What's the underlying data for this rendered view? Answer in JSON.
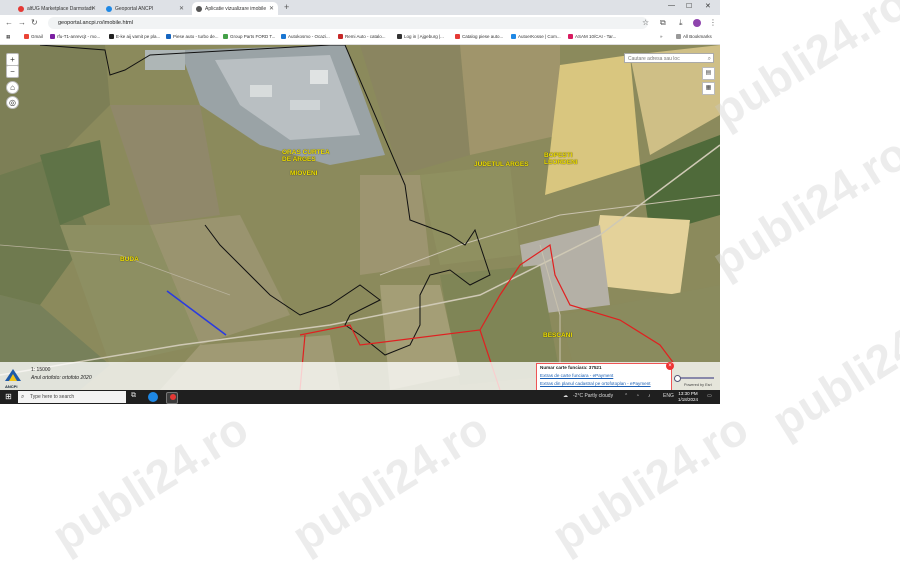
{
  "browser": {
    "tabs": [
      {
        "label": "altUG Marketplace Darmstadt",
        "active": false,
        "color": "#e53935"
      },
      {
        "label": "Geoportal ANCPI",
        "active": false,
        "color": "#1e88e5"
      },
      {
        "label": "Aplicatie vizualizare imobile",
        "active": true,
        "color": "#555555"
      }
    ],
    "new_tab": "+",
    "url": "geoportal.ancpi.ro/imobile.html",
    "bookmarks": [
      {
        "label": "Gmail",
        "color": "#ea4335"
      },
      {
        "label": "rfu-T1-anrevcjt - mo...",
        "color": "#7b1fa2"
      },
      {
        "label": "E-ke aij vamit pe pla...",
        "color": "#222222"
      },
      {
        "label": "Piese auto - turbo de...",
        "color": "#1565c0"
      },
      {
        "label": "Group Parts FORD T...",
        "color": "#43a047"
      },
      {
        "label": "Autokosmo - Ocazi...",
        "color": "#1976d2"
      },
      {
        "label": "Remi Auto - catalo...",
        "color": "#c62828"
      },
      {
        "label": "Log in | Ajgeburg |...",
        "color": "#333333"
      },
      {
        "label": "Catalog piese auto...",
        "color": "#e53935"
      },
      {
        "label": "AutoerKosse | Com...",
        "color": "#1e88e5"
      },
      {
        "label": "ASAM 10/CAI - Tar...",
        "color": "#d81b60"
      }
    ],
    "all_bookmarks": "All Bookmarks"
  },
  "map": {
    "search_placeholder": "Cautare adresa sau loc",
    "labels": [
      {
        "text": "ORAS CURTEA\nDE ARGES",
        "lines": [
          "ORAS CURTEA",
          "DE ARGES"
        ]
      },
      {
        "text": "MIOVENI",
        "lines": [
          "MIOVENI"
        ]
      },
      {
        "text": "JUDETUL ARGES",
        "lines": [
          "JUDETUL ARGES"
        ]
      },
      {
        "text": "BOPESTI LEORDENI",
        "lines": [
          "BOPESTI",
          "LEORDENI"
        ]
      },
      {
        "text": "BUDA",
        "lines": [
          "BUDA"
        ]
      },
      {
        "text": "BESCANI",
        "lines": [
          "BESCANI"
        ]
      }
    ],
    "zoom_in": "+",
    "zoom_out": "−",
    "scale": "1: 15000",
    "ortho": "Anul ortofoto: ortofoto 2020",
    "logo_text": "ANCPI"
  },
  "popup": {
    "line1": "Numar carte funciara: 37521",
    "line2": "Extras de carte funciara - ePayment",
    "line3": "Extras din planul cadastral pe ortofotoplan - ePayment",
    "powered": "Powered by Esri"
  },
  "taskbar": {
    "search_placeholder": "Type here to search",
    "weather": "-2°C  Partly cloudy",
    "lang": "ENG",
    "time": "13:30 PM",
    "date": "1/18/2024"
  },
  "watermark": "publi24.ro"
}
